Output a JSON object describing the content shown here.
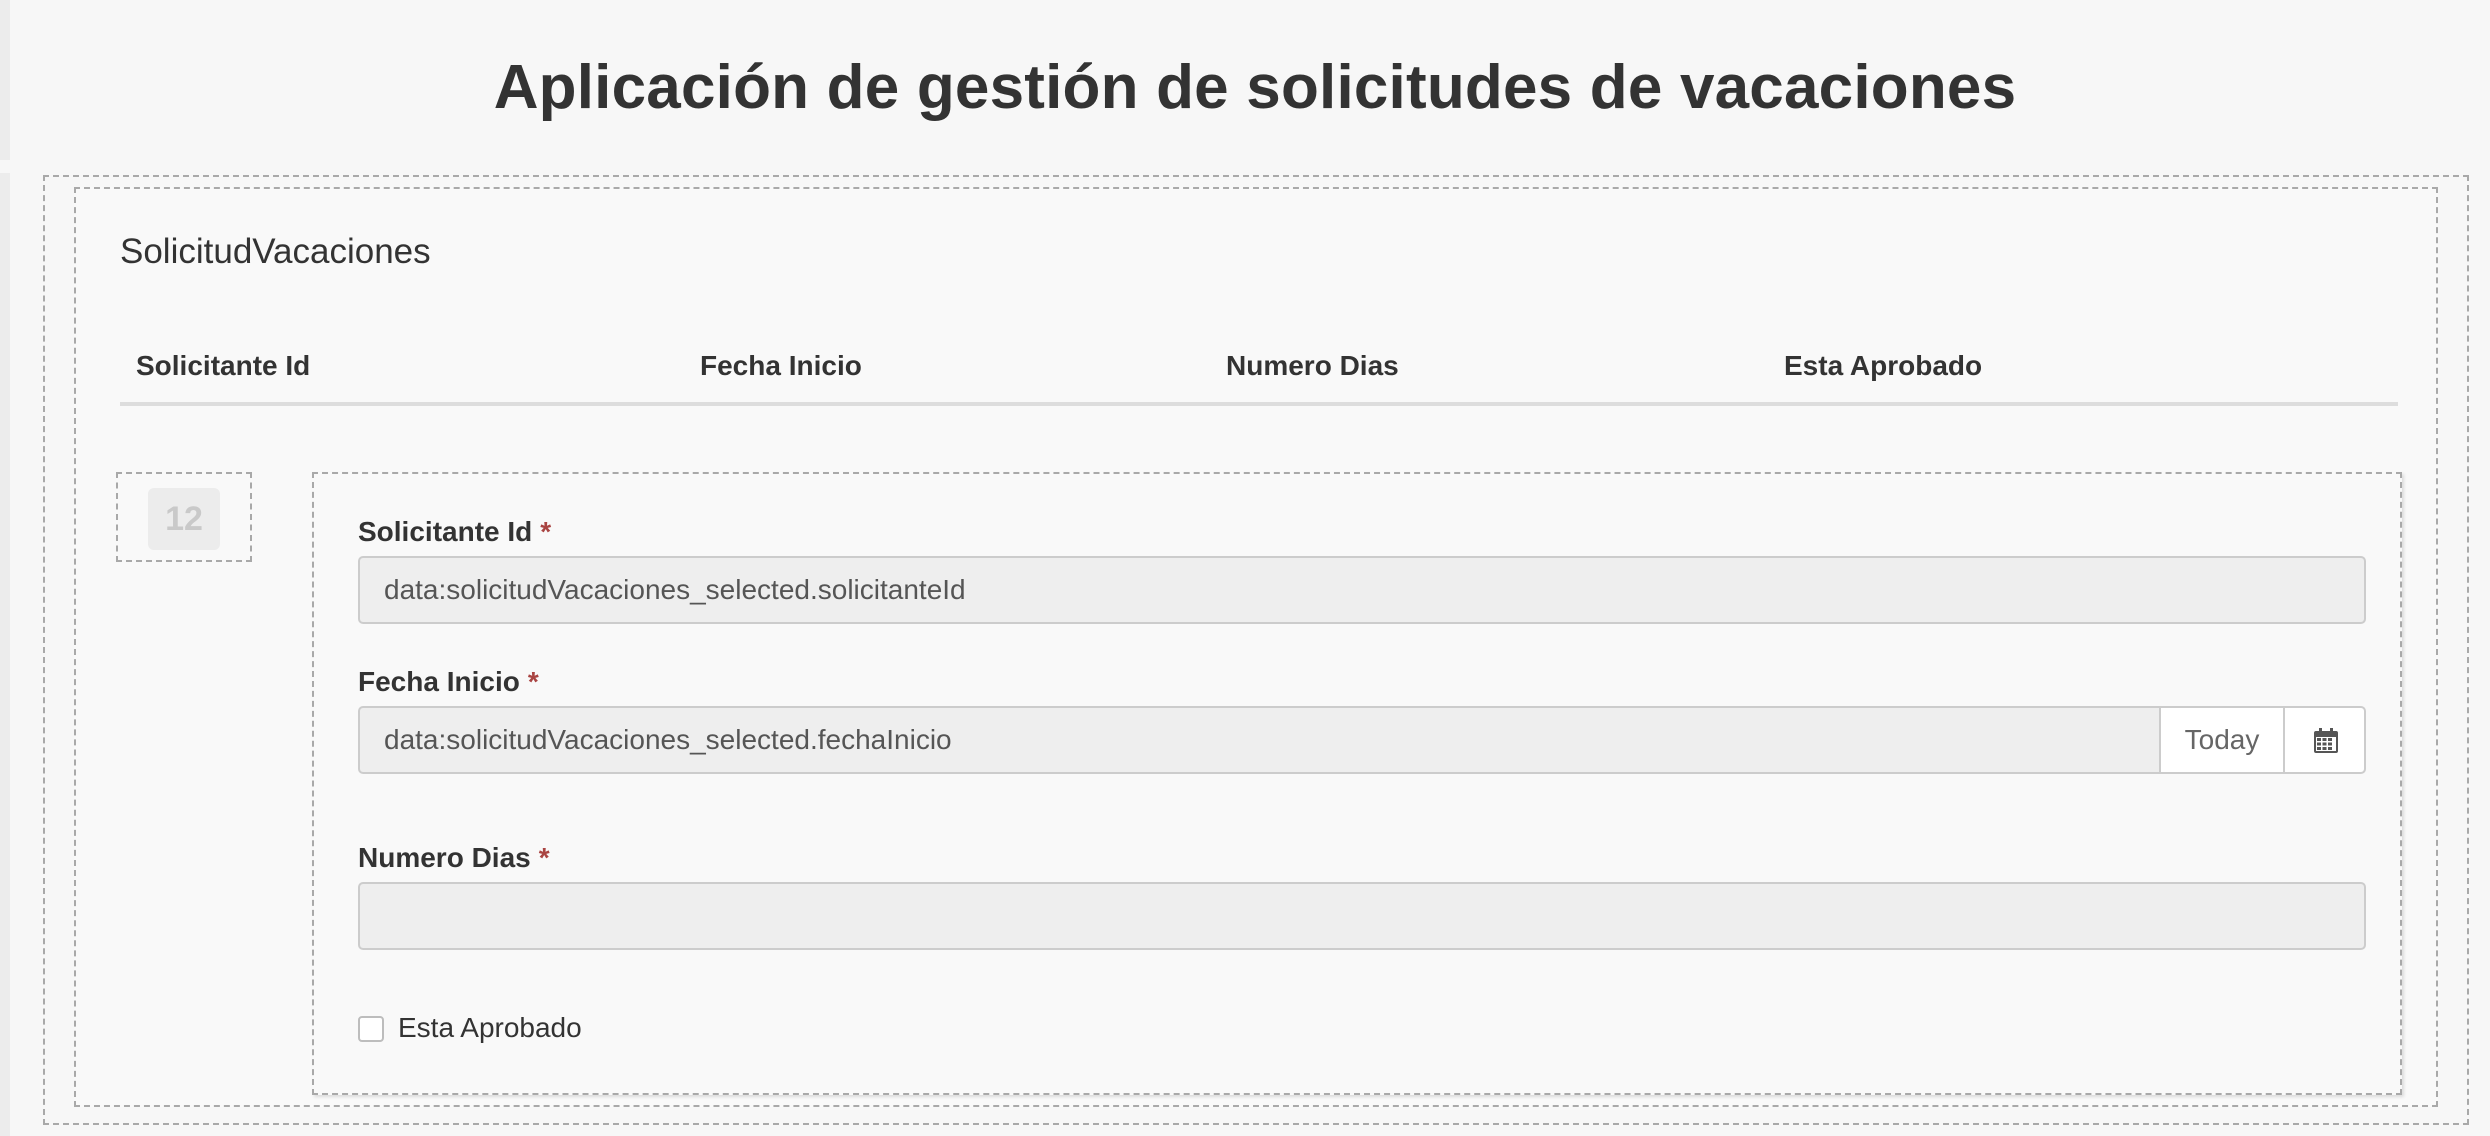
{
  "page": {
    "title": "Aplicación de gestión de solicitudes de vacaciones"
  },
  "entity": {
    "title": "SolicitudVacaciones",
    "columns": [
      "Solicitante Id",
      "Fecha Inicio",
      "Numero Dias",
      "Esta Aprobado"
    ]
  },
  "row": {
    "number": "12"
  },
  "form": {
    "required_mark": "*",
    "solicitante_id": {
      "label": "Solicitante Id",
      "value": "data:solicitudVacaciones_selected.solicitanteId"
    },
    "fecha_inicio": {
      "label": "Fecha Inicio",
      "value": "data:solicitudVacaciones_selected.fechaInicio",
      "today_label": "Today",
      "calendar_icon": "calendar-icon"
    },
    "numero_dias": {
      "label": "Numero Dias",
      "value": ""
    },
    "esta_aprobado": {
      "label": "Esta Aprobado",
      "checked": false
    }
  },
  "colors": {
    "required": "#a94442",
    "text": "#333333",
    "input_bg": "#eeeeee",
    "border": "#cccccc"
  }
}
